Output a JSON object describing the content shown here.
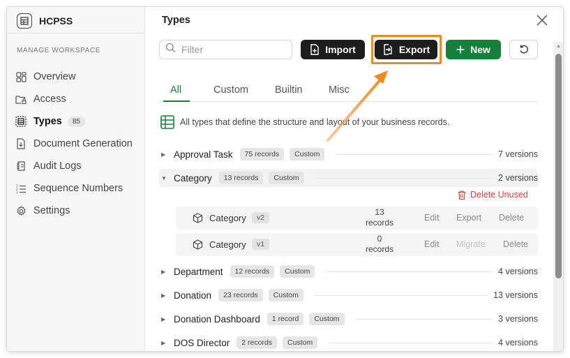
{
  "sidebar": {
    "app_name": "HCPSS",
    "section_title": "MANAGE WORKSPACE",
    "items": [
      {
        "label": "Overview"
      },
      {
        "label": "Access"
      },
      {
        "label": "Types",
        "count": "85"
      },
      {
        "label": "Document Generation"
      },
      {
        "label": "Audit Logs"
      },
      {
        "label": "Sequence Numbers"
      },
      {
        "label": "Settings"
      }
    ]
  },
  "header": {
    "title": "Types"
  },
  "toolbar": {
    "filter_placeholder": "Filter",
    "import_label": "Import",
    "export_label": "Export",
    "new_label": "New"
  },
  "tabs": [
    {
      "label": "All",
      "active": true
    },
    {
      "label": "Custom"
    },
    {
      "label": "Builtin"
    },
    {
      "label": "Misc"
    }
  ],
  "info_text": "All types that define the structure and layout of your business records.",
  "types": [
    {
      "name": "Approval Task",
      "records": "75 records",
      "kind": "Custom",
      "versions": "7 versions"
    },
    {
      "name": "Category",
      "records": "13 records",
      "kind": "Custom",
      "versions": "2 versions"
    },
    {
      "name": "Department",
      "records": "12 records",
      "kind": "Custom",
      "versions": "4 versions"
    },
    {
      "name": "Donation",
      "records": "23 records",
      "kind": "Custom",
      "versions": "13 versions"
    },
    {
      "name": "Donation Dashboard",
      "records": "1 record",
      "kind": "Custom",
      "versions": "3 versions"
    },
    {
      "name": "DOS Director",
      "records": "2 records",
      "kind": "Custom",
      "versions": "4 versions"
    }
  ],
  "expanded": {
    "delete_unused_label": "Delete Unused",
    "versions": [
      {
        "name": "Category",
        "version": "v2",
        "count": "13",
        "unit": "records",
        "actions": [
          "Edit",
          "Export",
          "Delete"
        ]
      },
      {
        "name": "Category",
        "version": "v1",
        "count": "0",
        "unit": "records",
        "actions": [
          "Edit",
          "Migrate",
          "Delete"
        ]
      }
    ]
  },
  "colors": {
    "accent_green": "#16803a",
    "highlight_orange": "#f08a1c",
    "danger_red": "#e0413a",
    "button_dark": "#1d1d1d"
  }
}
